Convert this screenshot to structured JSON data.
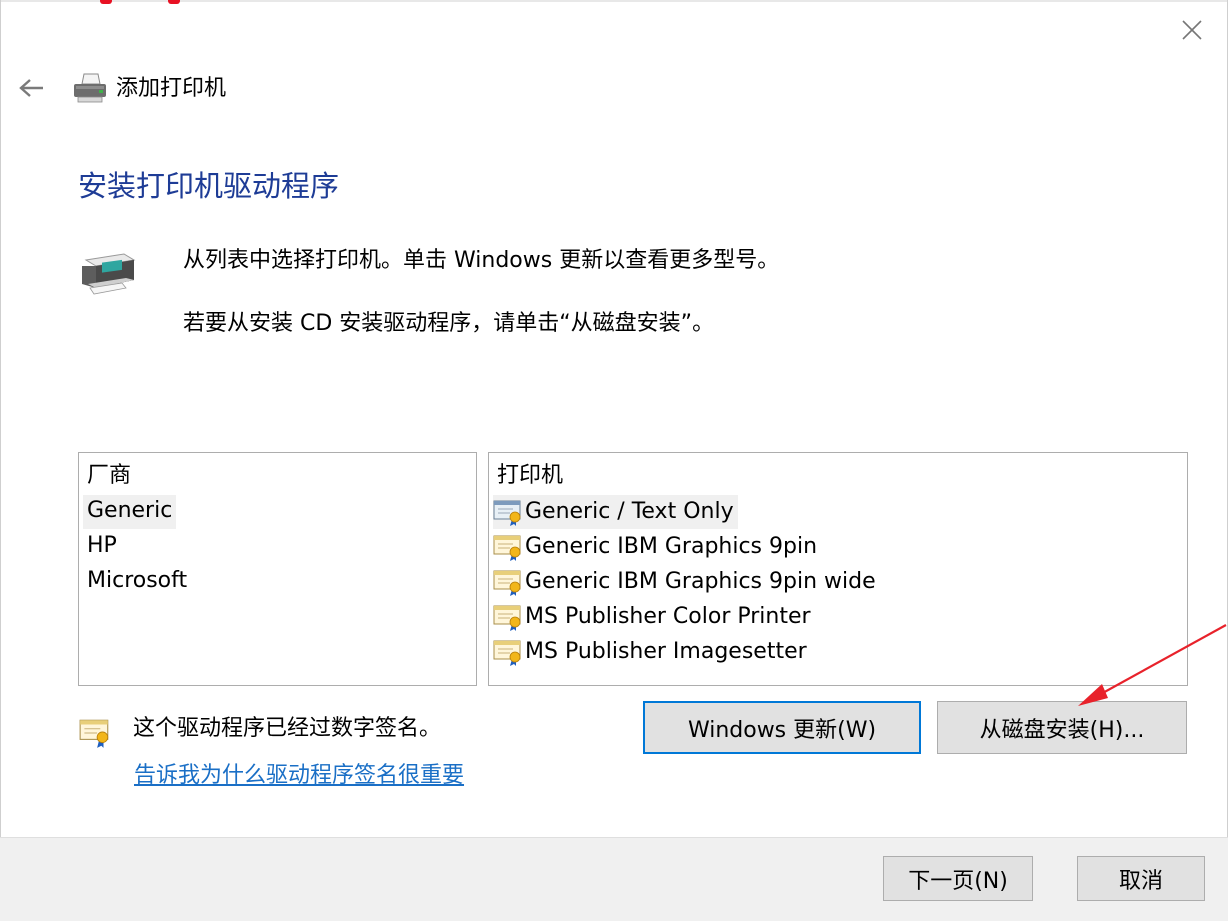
{
  "window": {
    "title": "添加打印机",
    "close_label": "×"
  },
  "page": {
    "heading": "安装打印机驱动程序",
    "instruction_1": "从列表中选择打印机。单击 Windows 更新以查看更多型号。",
    "instruction_2": "若要从安装 CD 安装驱动程序，请单击“从磁盘安装”。"
  },
  "manufacturers": {
    "header": "厂商",
    "items": [
      {
        "label": "Generic",
        "selected": true
      },
      {
        "label": "HP",
        "selected": false
      },
      {
        "label": "Microsoft",
        "selected": false
      }
    ]
  },
  "printers": {
    "header": "打印机",
    "items": [
      {
        "label": "Generic / Text Only",
        "selected": true
      },
      {
        "label": "Generic IBM Graphics 9pin",
        "selected": false
      },
      {
        "label": "Generic IBM Graphics 9pin wide",
        "selected": false
      },
      {
        "label": "MS Publisher Color Printer",
        "selected": false
      },
      {
        "label": "MS Publisher Imagesetter",
        "selected": false
      }
    ]
  },
  "signature": {
    "text": "这个驱动程序已经过数字签名。",
    "link": "告诉我为什么驱动程序签名很重要"
  },
  "buttons": {
    "windows_update": "Windows 更新(W)",
    "have_disk": "从磁盘安装(H)...",
    "next": "下一页(N)",
    "cancel": "取消"
  },
  "colors": {
    "heading": "#1e3c96",
    "link": "#1a6fc6",
    "default_button_border": "#0078d7",
    "annotation_arrow": "#e8222b"
  },
  "icons": [
    "close-icon",
    "back-arrow-icon",
    "printer-icon",
    "certificate-icon"
  ]
}
